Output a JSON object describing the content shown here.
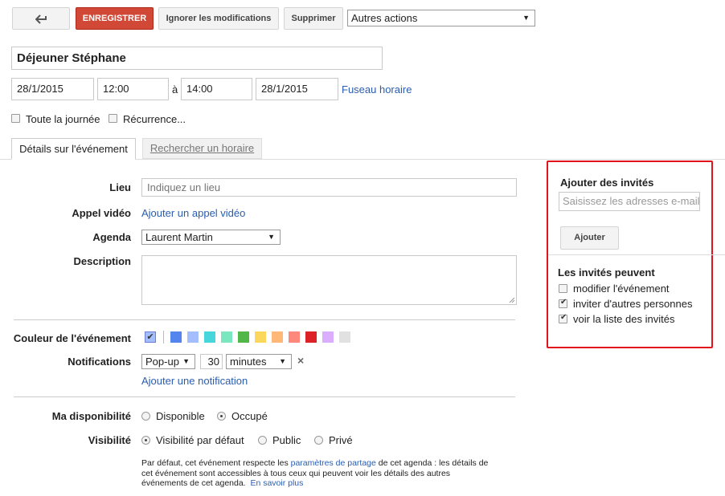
{
  "toolbar": {
    "back_icon": "back-arrow-icon",
    "save_label": "ENREGISTRER",
    "discard_label": "Ignorer les modifications",
    "delete_label": "Supprimer",
    "more_actions_label": "Autres actions"
  },
  "event": {
    "title": "Déjeuner Stéphane",
    "start_date": "28/1/2015",
    "start_time": "12:00",
    "to_label": "à",
    "end_time": "14:00",
    "end_date": "28/1/2015",
    "timezone_label": "Fuseau horaire",
    "all_day_label": "Toute la journée",
    "all_day_checked": false,
    "recurrence_label": "Récurrence...",
    "recurrence_checked": false
  },
  "tabs": [
    {
      "label": "Détails sur l'événement",
      "active": true
    },
    {
      "label": "Rechercher un horaire",
      "active": false
    }
  ],
  "details": {
    "location_label": "Lieu",
    "location_placeholder": "Indiquez un lieu",
    "video_label": "Appel vidéo",
    "video_link": "Ajouter un appel vidéo",
    "calendar_label": "Agenda",
    "calendar_value": "Laurent Martin",
    "description_label": "Description",
    "color_label": "Couleur de l'événement",
    "colors": [
      "#a4bdfc",
      "#5484ed",
      "#a4bdfc",
      "#46d6db",
      "#7ae7bf",
      "#51b749",
      "#fbd75b",
      "#ffb878",
      "#ff887c",
      "#dc2127",
      "#dbadff",
      "#e1e1e1"
    ],
    "notifications_label": "Notifications",
    "notification_type": "Pop-up",
    "notification_amount": "30",
    "notification_unit": "minutes",
    "remove_icon": "close-icon",
    "add_notification_link": "Ajouter une notification",
    "availability_label": "Ma disponibilité",
    "availability_options": [
      {
        "label": "Disponible",
        "checked": false
      },
      {
        "label": "Occupé",
        "checked": true
      }
    ],
    "visibility_label": "Visibilité",
    "visibility_options": [
      {
        "label": "Visibilité par défaut",
        "checked": true
      },
      {
        "label": "Public",
        "checked": false
      },
      {
        "label": "Privé",
        "checked": false
      }
    ],
    "note_part1": "Par défaut, cet événement respecte les",
    "note_link1": "paramètres de partage",
    "note_part2": "de cet agenda : les détails de",
    "note_line2": "cet événement sont accessibles à tous ceux qui peuvent voir les détails des autres",
    "note_line3": "événements de cet agenda.",
    "note_link2": "En savoir plus"
  },
  "guests": {
    "title": "Ajouter des invités",
    "input_placeholder": "Saisissez les adresses e-mail",
    "add_button": "Ajouter",
    "permissions_title": "Les invités peuvent",
    "permissions": [
      {
        "label": "modifier l'événement",
        "checked": false
      },
      {
        "label": "inviter d'autres personnes",
        "checked": true
      },
      {
        "label": "voir la liste des invités",
        "checked": true
      }
    ],
    "highlight_color": "#e1141c"
  }
}
